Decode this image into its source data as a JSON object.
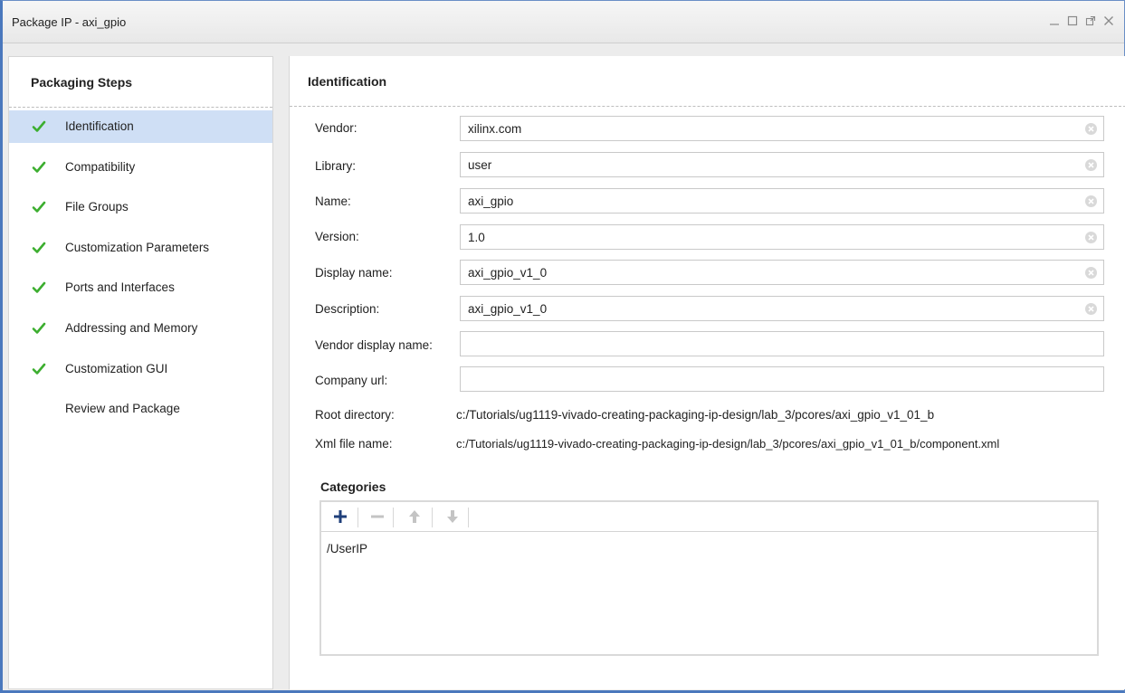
{
  "window": {
    "title": "Package IP - axi_gpio"
  },
  "colors": {
    "accent": "#4a78bd",
    "selection": "#cfdff5",
    "check": "#3cae2f"
  },
  "left": {
    "header": "Packaging Steps",
    "steps": [
      {
        "label": "Identification",
        "checked": true,
        "selected": true
      },
      {
        "label": "Compatibility",
        "checked": true
      },
      {
        "label": "File Groups",
        "checked": true
      },
      {
        "label": "Customization Parameters",
        "checked": true
      },
      {
        "label": "Ports and Interfaces",
        "checked": true
      },
      {
        "label": "Addressing and Memory",
        "checked": true
      },
      {
        "label": "Customization GUI",
        "checked": true
      },
      {
        "label": "Review and Package",
        "checked": false
      }
    ]
  },
  "right": {
    "header": "Identification",
    "fields": {
      "vendor": {
        "label": "Vendor:",
        "value": "xilinx.com"
      },
      "library": {
        "label": "Library:",
        "value": "user"
      },
      "name": {
        "label": "Name:",
        "value": "axi_gpio"
      },
      "version": {
        "label": "Version:",
        "value": "1.0"
      },
      "display_name": {
        "label": "Display name:",
        "value": "axi_gpio_v1_0"
      },
      "description": {
        "label": "Description:",
        "value": "axi_gpio_v1_0"
      },
      "vendor_display_name": {
        "label": "Vendor display name:",
        "value": ""
      },
      "company_url": {
        "label": "Company url:",
        "value": ""
      }
    },
    "root_directory": {
      "label": "Root directory:",
      "value": "c:/Tutorials/ug1119-vivado-creating-packaging-ip-design/lab_3/pcores/axi_gpio_v1_01_b"
    },
    "xml_file_name": {
      "label": "Xml file name:",
      "value": "c:/Tutorials/ug1119-vivado-creating-packaging-ip-design/lab_3/pcores/axi_gpio_v1_01_b/component.xml"
    },
    "categories": {
      "title": "Categories",
      "items": [
        "/UserIP"
      ]
    }
  }
}
